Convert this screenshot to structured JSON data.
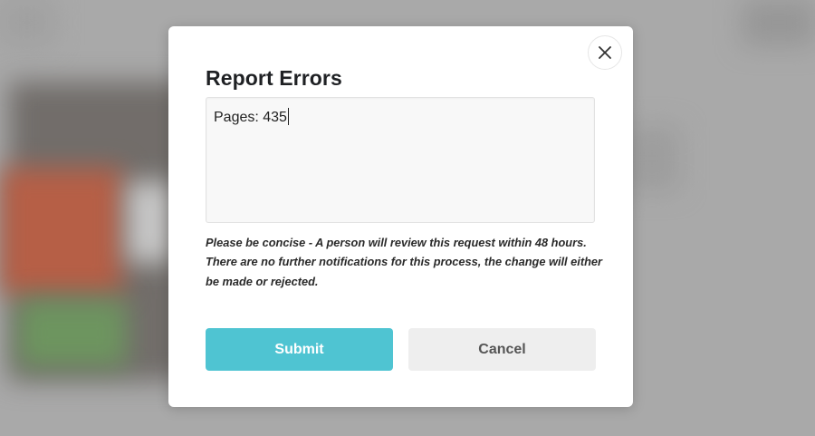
{
  "modal": {
    "title": "Report Errors",
    "textarea": {
      "value": "Pages: 435"
    },
    "note": "Please be concise - A person will review this request within 48 hours. There are no further notifications for this process, the change will either be made or rejected.",
    "buttons": {
      "submit_label": "Submit",
      "cancel_label": "Cancel"
    },
    "close_icon": "close-icon"
  },
  "colors": {
    "submit": "#4fc4d2",
    "cancel": "#eeeeee",
    "title": "#1f2124"
  }
}
